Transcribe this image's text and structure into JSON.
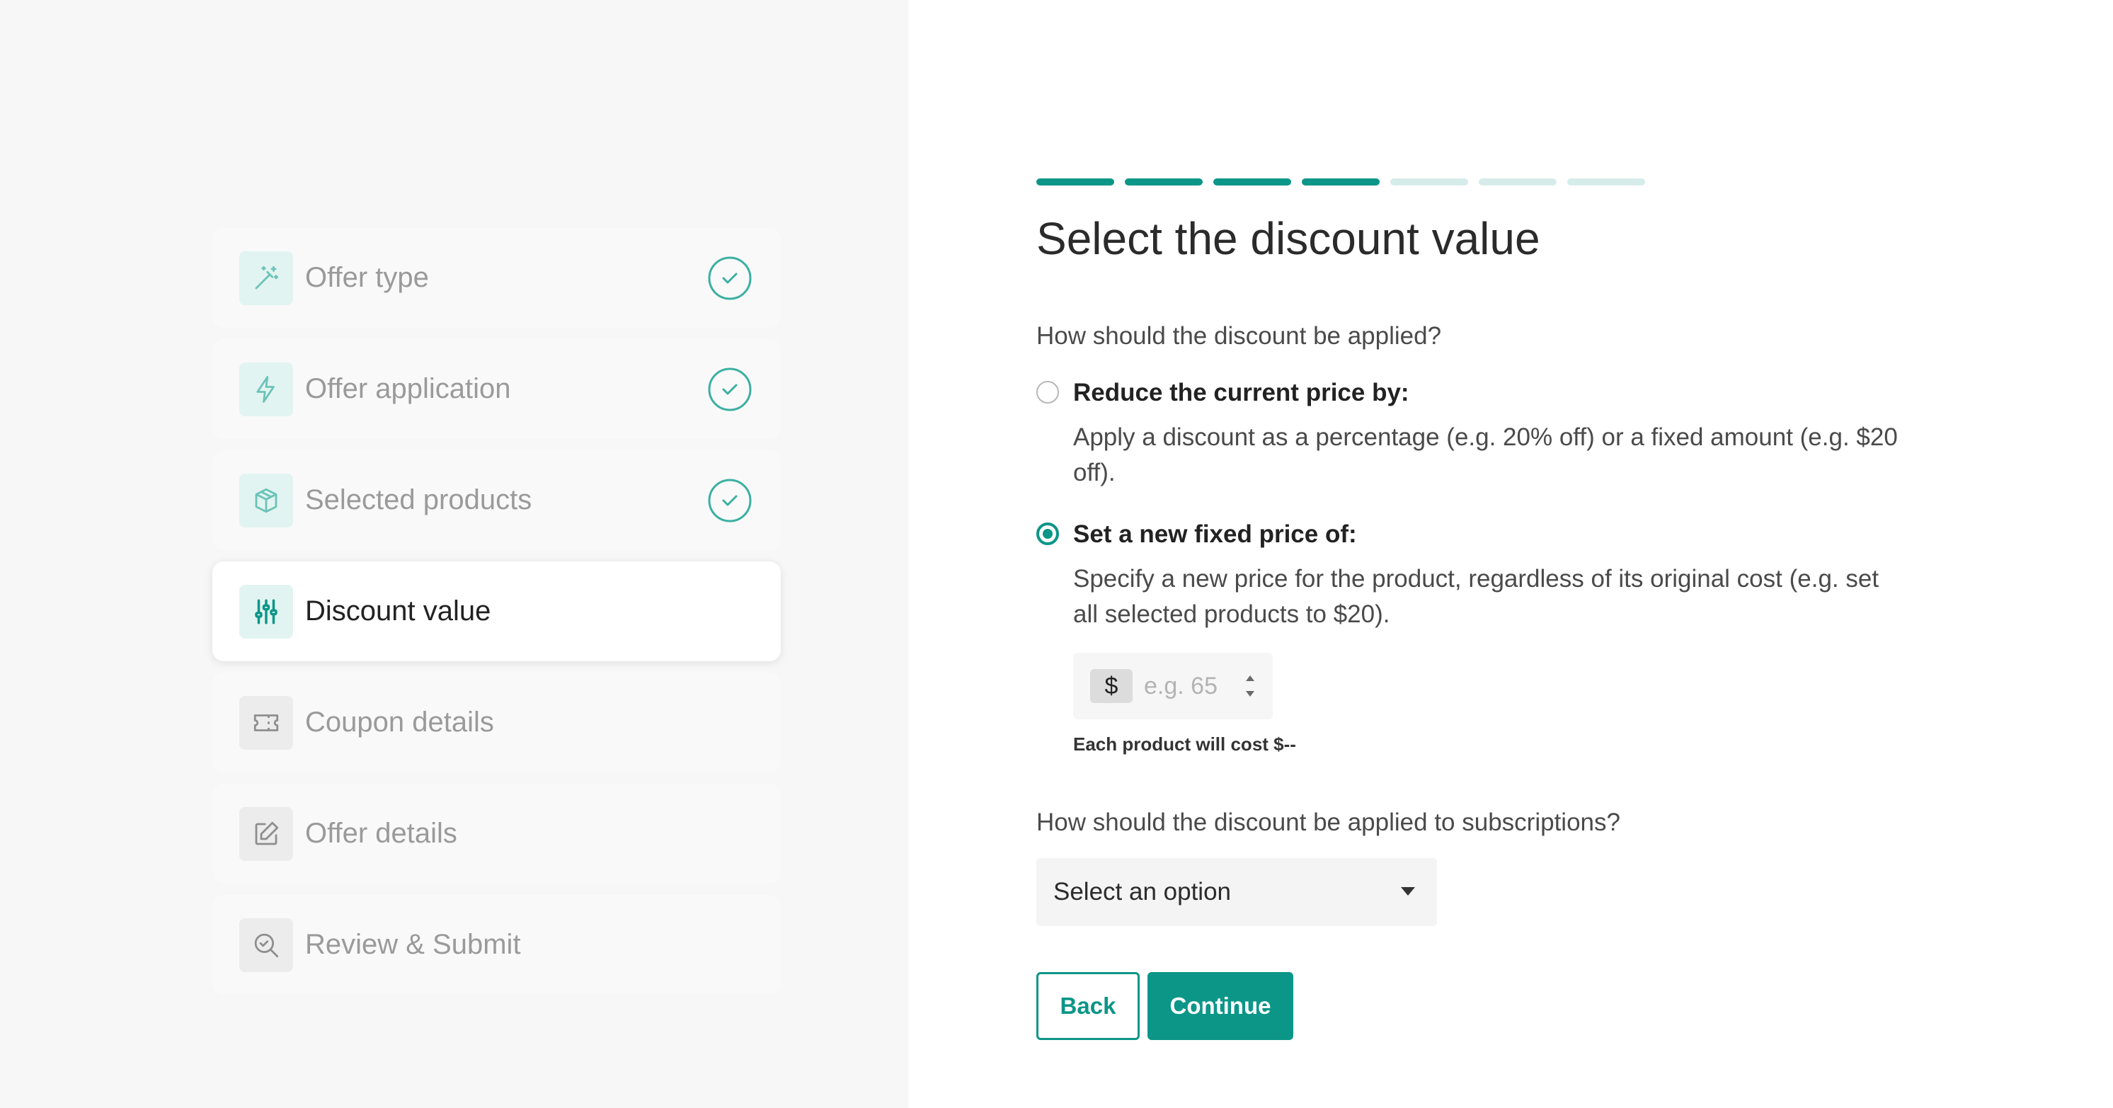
{
  "sidebar": {
    "steps": [
      {
        "label": "Offer type",
        "icon": "magic-wand-icon",
        "status": "done"
      },
      {
        "label": "Offer application",
        "icon": "lightning-icon",
        "status": "done"
      },
      {
        "label": "Selected products",
        "icon": "box-icon",
        "status": "done"
      },
      {
        "label": "Discount value",
        "icon": "sliders-icon",
        "status": "active"
      },
      {
        "label": "Coupon details",
        "icon": "ticket-icon",
        "status": "pending"
      },
      {
        "label": "Offer details",
        "icon": "edit-icon",
        "status": "pending"
      },
      {
        "label": "Review & Submit",
        "icon": "search-check-icon",
        "status": "pending"
      }
    ]
  },
  "progress": {
    "completed": 4,
    "total": 7
  },
  "main": {
    "title": "Select the discount value",
    "question1": "How should the discount be applied?",
    "option_reduce": {
      "title": "Reduce the current price by:",
      "description": "Apply a discount as a percentage (e.g. 20% off) or a fixed amount (e.g. $20 off).",
      "selected": false
    },
    "option_fixed": {
      "title": "Set a new fixed price of:",
      "description": "Specify a new price for the product, regardless of its original cost (e.g. set all selected products to $20).",
      "selected": true
    },
    "price_input": {
      "currency": "$",
      "placeholder": "e.g. 65",
      "value": ""
    },
    "helper_text": "Each product will cost $--",
    "question2": "How should the discount be applied to subscriptions?",
    "subscription_select": {
      "value": "Select an option"
    },
    "back_label": "Back",
    "continue_label": "Continue"
  },
  "colors": {
    "accent": "#0c9688",
    "accent_light": "#d6ecea",
    "sidebar_bg": "#f7f7f7"
  }
}
